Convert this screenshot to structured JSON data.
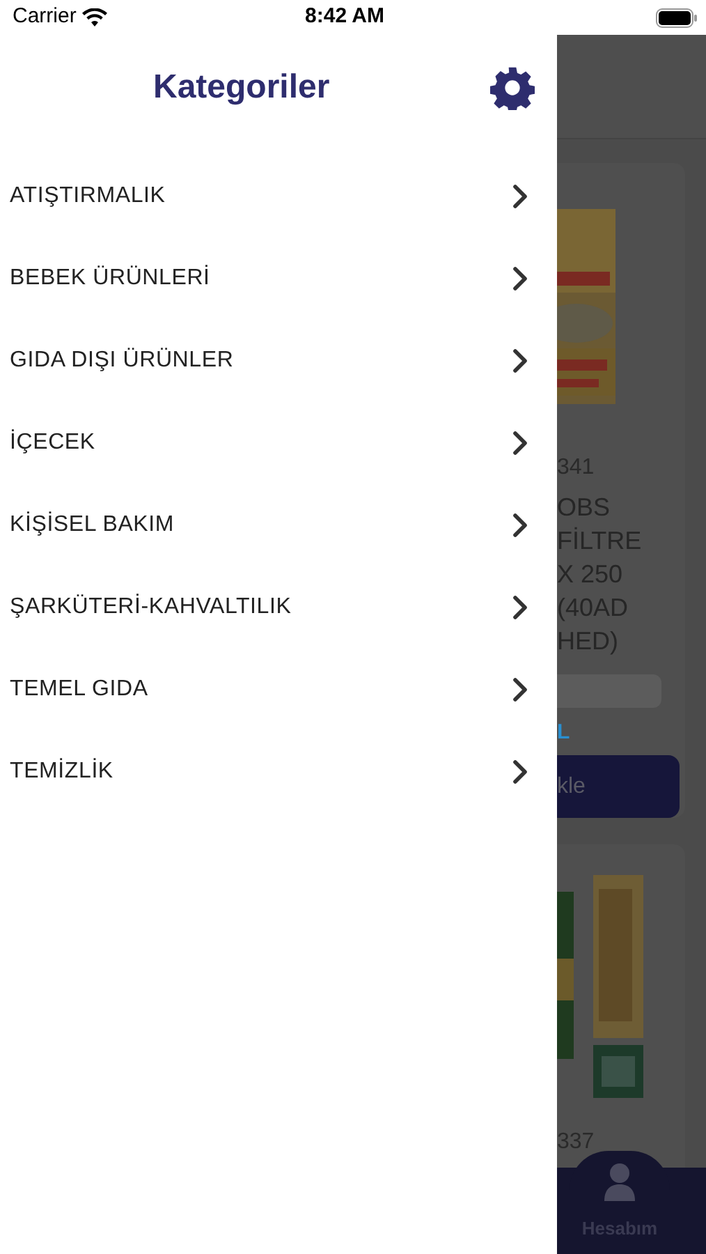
{
  "status_bar": {
    "carrier": "Carrier",
    "time": "8:42 AM"
  },
  "drawer": {
    "title": "Kategoriler",
    "categories": [
      {
        "label": "ATIŞTIRMALIK"
      },
      {
        "label": "BEBEK ÜRÜNLERİ"
      },
      {
        "label": "GIDA DIŞI ÜRÜNLER"
      },
      {
        "label": "İÇECEK"
      },
      {
        "label": "KİŞİSEL BAKIM"
      },
      {
        "label": "ŞARKÜTERİ-KAHVALTILIK"
      },
      {
        "label": "TEMEL GIDA"
      },
      {
        "label": "TEMİZLİK"
      }
    ]
  },
  "background": {
    "products": [
      {
        "code": "341",
        "name": "OBS\nFİLTRE\nX 250\n(40AD\nHED)",
        "price": "L",
        "button": "kle"
      },
      {
        "code": "337"
      }
    ],
    "tab_bar": {
      "label": "Hesabım"
    }
  }
}
